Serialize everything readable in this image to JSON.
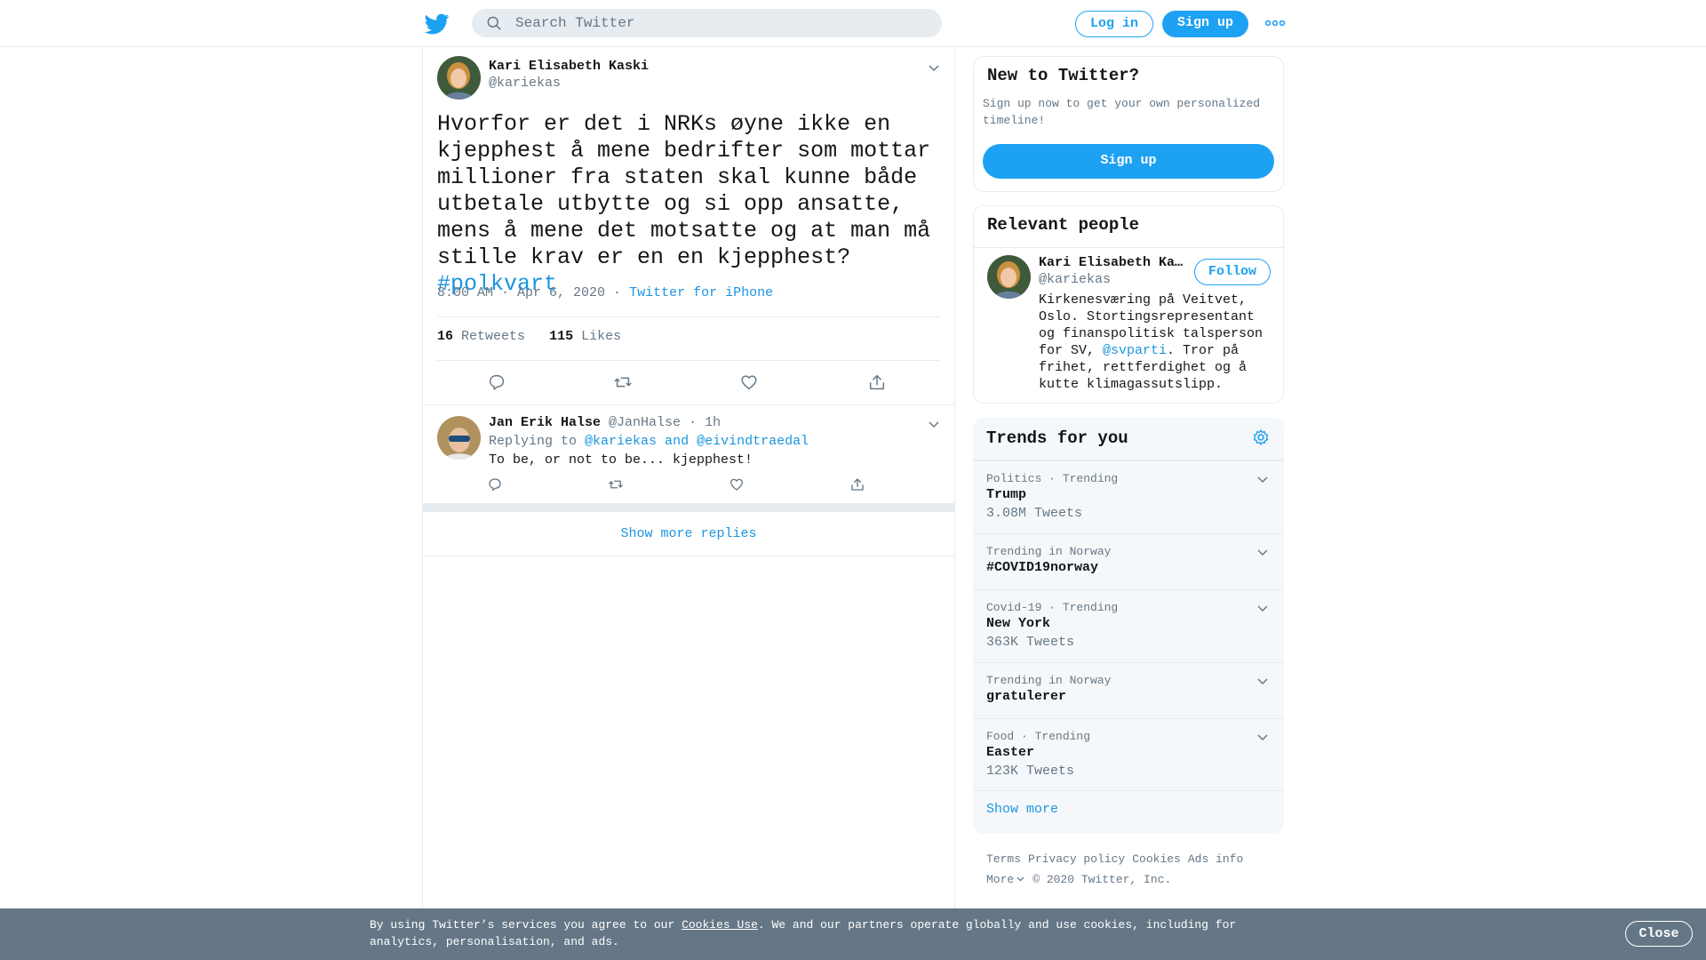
{
  "header": {
    "search_placeholder": "Search Twitter",
    "login_label": "Log in",
    "signup_label": "Sign up"
  },
  "tweet": {
    "author_name": "Kari Elisabeth Kaski",
    "author_handle": "@kariekas",
    "text": "Hvorfor er det i NRKs øyne ikke en kjepphest å mene bedrifter som mottar millioner fra staten skal kunne både utbetale utbytte og si opp ansatte, mens å mene det motsatte og at man må stille krav er en en kjepphest?",
    "hashtag": "#polkvart",
    "timestamp": "8:00 AM · Apr 6, 2020",
    "separator": "·",
    "source": "Twitter for iPhone",
    "retweets_count": "16",
    "retweets_label": "Retweets",
    "likes_count": "115",
    "likes_label": "Likes"
  },
  "reply": {
    "author_name": "Jan Erik Halse",
    "author_handle": "@JanHalse",
    "time": "· 1h",
    "replying_prefix": "Replying to",
    "replying_mentions": "@kariekas and @eivindtraedal",
    "text": "To be, or not to be... kjepphest!"
  },
  "show_more_replies": "Show more replies",
  "sidebar": {
    "new_to_twitter": {
      "title": "New to Twitter?",
      "text": "Sign up now to get your own personalized timeline!",
      "button": "Sign up"
    },
    "relevant_people": {
      "title": "Relevant people",
      "name": "Kari Elisabeth Ka…",
      "handle": "@kariekas",
      "follow_label": "Follow",
      "bio_before": "Kirkenesværing på Veitvet, Oslo. Stortingsrepresentant og finanspolitisk talsperson for SV, ",
      "bio_mention": "@svparti",
      "bio_after": ". Tror på frihet, rettferdighet og å kutte klimagassutslipp."
    },
    "trends": {
      "title": "Trends for you",
      "items": [
        {
          "meta": "Politics · Trending",
          "name": "Trump",
          "count": "3.08M Tweets"
        },
        {
          "meta": "Trending in Norway",
          "name": "#COVID19norway",
          "count": ""
        },
        {
          "meta": "Covid-19 · Trending",
          "name": "New York",
          "count": "363K Tweets"
        },
        {
          "meta": "Trending in Norway",
          "name": "gratulerer",
          "count": ""
        },
        {
          "meta": "Food · Trending",
          "name": "Easter",
          "count": "123K Tweets"
        }
      ],
      "show_more": "Show more"
    },
    "footer": {
      "terms": "Terms",
      "privacy": "Privacy policy",
      "cookies": "Cookies",
      "ads": "Ads info",
      "more": "More",
      "copyright": "© 2020 Twitter, Inc."
    }
  },
  "cookie_bar": {
    "text_before": "By using Twitter’s services you agree to our ",
    "link": "Cookies Use",
    "text_after": ". We and our partners operate globally and use cookies, including for analytics, personalisation, and ads.",
    "close_label": "Close"
  },
  "colors": {
    "accent": "#1da1f2",
    "link": "#1b95e0",
    "muted": "#657786",
    "border": "#e6ecf0",
    "cookie_bar": "#657786"
  },
  "icons": [
    "twitter-bird-icon",
    "search-icon",
    "more-dots-icon",
    "chevron-down-icon",
    "reply-icon",
    "retweet-icon",
    "like-icon",
    "share-icon",
    "gear-icon"
  ]
}
